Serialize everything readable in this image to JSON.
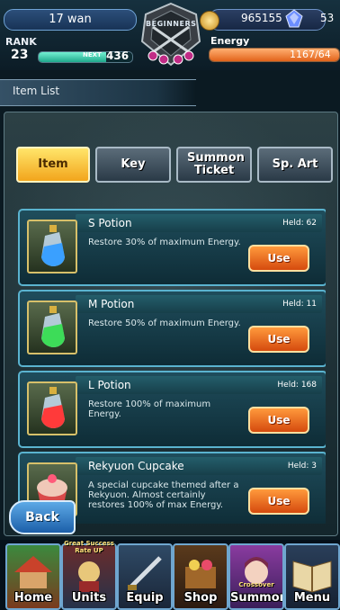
{
  "status": {
    "player_name": "17 wan",
    "rank_label": "RANK",
    "rank": "23",
    "next_label": "NEXT",
    "next_exp": "436",
    "exp_fraction": 0.72,
    "emblem_text": "BEGINNERS",
    "gil": "965155",
    "gems": "53",
    "energy_label": "Energy",
    "energy": "1167/64",
    "energy_fraction": 1.0
  },
  "header": {
    "title": "Item List"
  },
  "tabs": [
    {
      "label": "Item",
      "active": true
    },
    {
      "label": "Key",
      "active": false
    },
    {
      "label": "Summon Ticket",
      "active": false
    },
    {
      "label": "Sp. Art",
      "active": false
    }
  ],
  "items": [
    {
      "name": "S Potion",
      "held": "Held: 62",
      "desc": "Restore 30% of maximum Energy.",
      "button": "Use",
      "potion_color": "#3aa0ff",
      "icon": "blue-potion-icon"
    },
    {
      "name": "M Potion",
      "held": "Held: 11",
      "desc": "Restore 50% of maximum Energy.",
      "button": "Use",
      "potion_color": "#3ddc58",
      "icon": "green-potion-icon"
    },
    {
      "name": "L Potion",
      "held": "Held: 168",
      "desc": "Restore 100% of maximum Energy.",
      "button": "Use",
      "potion_color": "#ff3a3a",
      "icon": "red-potion-icon"
    },
    {
      "name": "Rekyuon Cupcake",
      "held": "Held: 3",
      "desc": "A special cupcake themed after a Rekyuon. Almost certainly restores 100% of max Energy.",
      "button": "Use",
      "potion_color": "#f0c8b8",
      "icon": "cupcake-icon"
    }
  ],
  "back_label": "Back",
  "nav": [
    {
      "label": "Home",
      "icon": "home-icon"
    },
    {
      "label": "Units",
      "icon": "units-icon",
      "badge": "Great Success Rate UP"
    },
    {
      "label": "Equip",
      "icon": "equip-icon"
    },
    {
      "label": "Shop",
      "icon": "shop-icon"
    },
    {
      "label": "Summon",
      "icon": "summon-icon",
      "badge": "Crossover"
    },
    {
      "label": "Menu",
      "icon": "menu-icon"
    }
  ]
}
